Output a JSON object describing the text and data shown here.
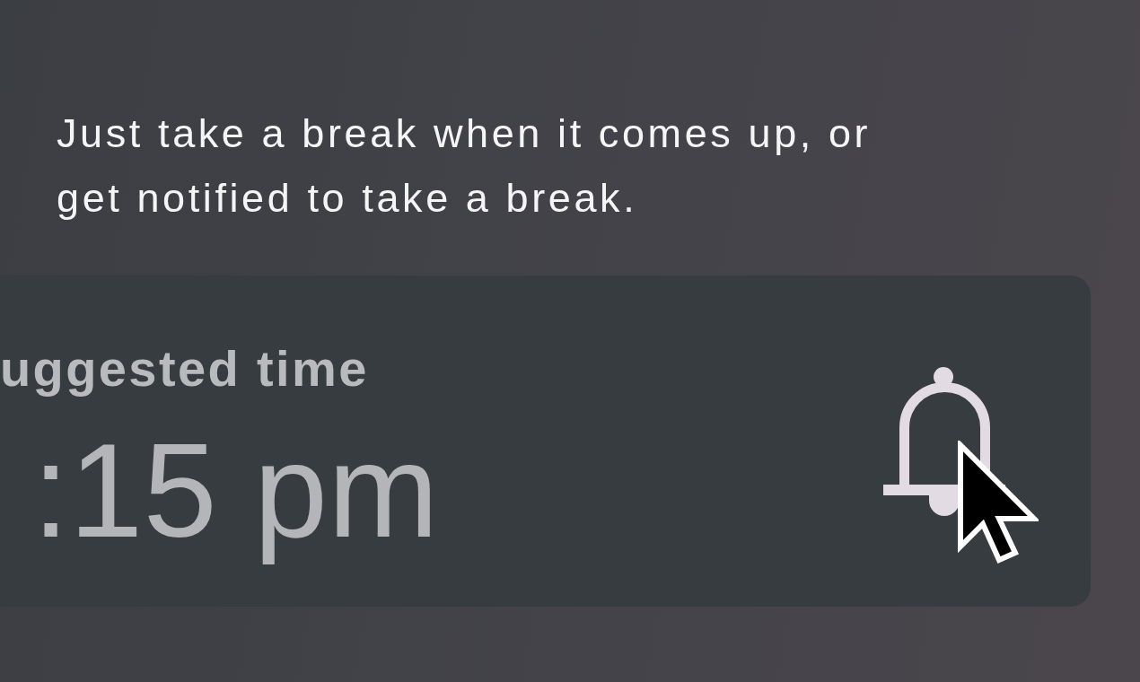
{
  "message": {
    "text": "Just take a break when it comes up, or get notified to take a break."
  },
  "suggestion_card": {
    "label": "uggested time",
    "time": ":15 pm"
  }
}
